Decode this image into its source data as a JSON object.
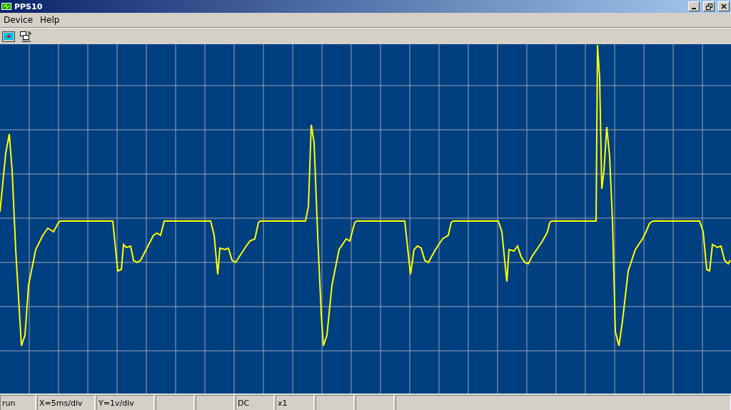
{
  "window": {
    "title": "PPS10"
  },
  "menu": [
    "Device",
    "Help"
  ],
  "status_bar": [
    {
      "kind": "text",
      "text": "run"
    },
    {
      "kind": "text",
      "text": "X=5ms/div"
    },
    {
      "kind": "text",
      "text": "Y=1v/div"
    },
    {
      "kind": "blank"
    },
    {
      "kind": "blank"
    },
    {
      "kind": "text",
      "text": "DC"
    },
    {
      "kind": "text",
      "text": "x1"
    },
    {
      "kind": "blank"
    },
    {
      "kind": "blank"
    },
    {
      "kind": "wide"
    }
  ]
}
